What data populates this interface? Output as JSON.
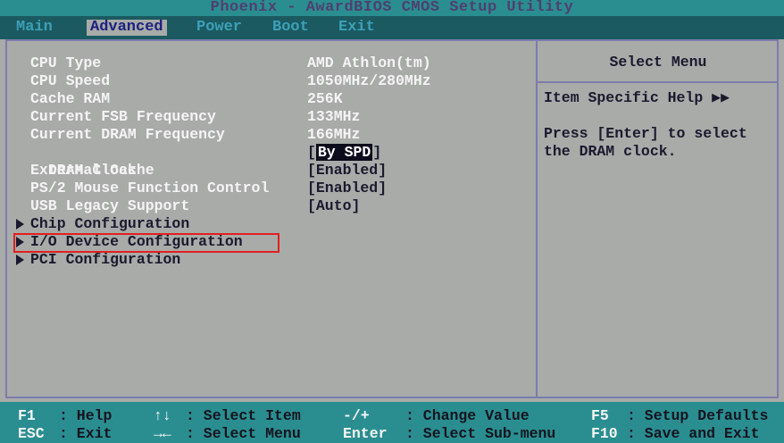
{
  "window": {
    "title": "Phoenix - AwardBIOS CMOS Setup Utility"
  },
  "menu": {
    "tabs": [
      {
        "label": "Main",
        "active": false
      },
      {
        "label": "Advanced",
        "active": true
      },
      {
        "label": "Power",
        "active": false
      },
      {
        "label": "Boot",
        "active": false
      },
      {
        "label": "Exit",
        "active": false
      }
    ]
  },
  "settings": [
    {
      "label": "CPU Type",
      "value": "AMD Athlon(tm)"
    },
    {
      "label": "CPU Speed",
      "value": "1050MHz/280MHz"
    },
    {
      "label": "Cache RAM",
      "value": "256K"
    },
    {
      "label": "Current FSB Frequency",
      "value": "133MHz"
    },
    {
      "label": "Current DRAM Frequency",
      "value": "166MHz"
    },
    {
      "label": "DRAM Clock",
      "value": "By SPD",
      "selected": true
    },
    {
      "label": "External Cache",
      "value": "[Enabled]"
    },
    {
      "label": "PS/2 Mouse Function Control",
      "value": "[Enabled]"
    },
    {
      "label": "USB Legacy Support",
      "value": "[Auto]"
    }
  ],
  "submenus": [
    {
      "label": "Chip Configuration"
    },
    {
      "label": "I/O Device Configuration",
      "highlighted": true
    },
    {
      "label": "PCI Configuration"
    }
  ],
  "help": {
    "header": "Select Menu",
    "item_specific": "Item Specific Help ▶▶",
    "text": "Press [Enter] to select\nthe DRAM clock."
  },
  "footer": {
    "row1": [
      {
        "key": "F1",
        "desc": ": Help"
      },
      {
        "key": "↑↓",
        "desc": ": Select Item"
      },
      {
        "key": "-/+",
        "desc": ": Change Value"
      },
      {
        "key": "F5",
        "desc": ": Setup Defaults"
      }
    ],
    "row2": [
      {
        "key": "ESC",
        "desc": ": Exit"
      },
      {
        "key": "→←",
        "desc": ": Select Menu"
      },
      {
        "key": "Enter",
        "desc": ": Select Sub-menu"
      },
      {
        "key": "F10",
        "desc": ": Save and Exit"
      }
    ]
  },
  "colors": {
    "background": "#a8aba8",
    "title_bar": "#2a8e91",
    "menu_bar": "#1a5a60",
    "highlight_box": "#e02020"
  }
}
